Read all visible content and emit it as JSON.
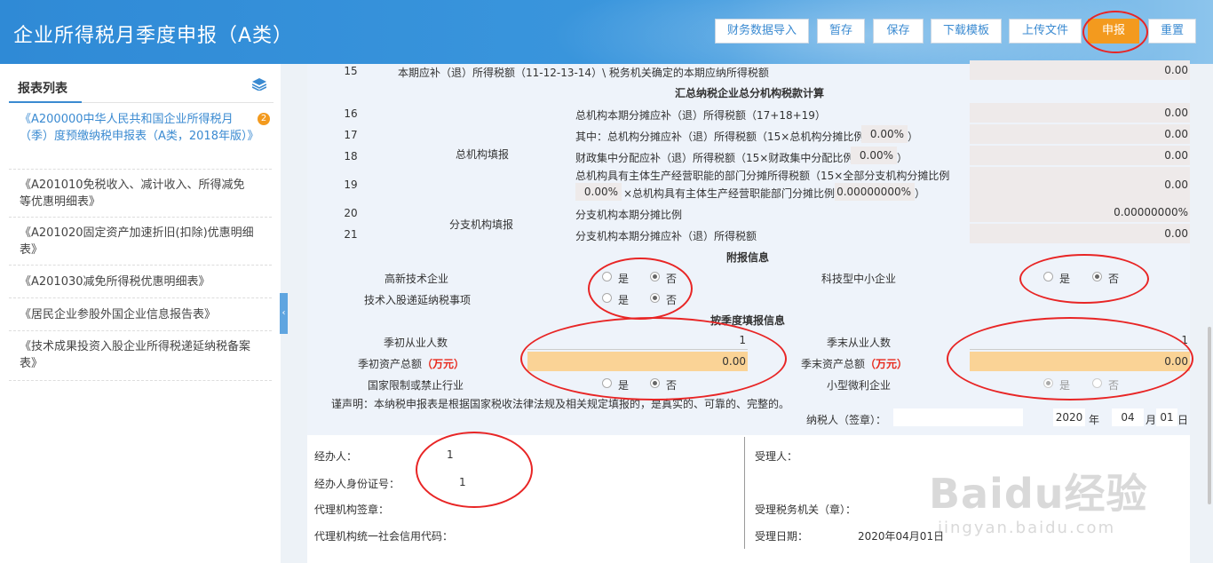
{
  "header": {
    "title": "企业所得税月季度申报（A类）",
    "buttons": [
      "财务数据导入",
      "暂存",
      "保存",
      "下载模板",
      "上传文件",
      "申报",
      "重置"
    ]
  },
  "sidebar": {
    "title": "报表列表",
    "badge": "2",
    "items": [
      "《A200000中华人民共和国企业所得税月（季）度预缴纳税申报表（A类，2018年版）》",
      "《A201010免税收入、减计收入、所得减免等优惠明细表》",
      "《A201020固定资产加速折旧(扣除)优惠明细表》",
      "《A201030减免所得税优惠明细表》",
      "《居民企业参股外国企业信息报告表》",
      "《技术成果投资入股企业所得税递延纳税备案表》"
    ]
  },
  "form": {
    "row15": {
      "num": "15",
      "label": "本期应补（退）所得税额（11-12-13-14）\\ 税务机关确定的本期应纳所得税额",
      "value": "0.00"
    },
    "section_hq": "汇总纳税企业总分机构税款计算",
    "hq_group": "总机构填报",
    "branch_group": "分支机构填报",
    "row16": {
      "num": "16",
      "label": "总机构本期分摊应补（退）所得税额（17+18+19）",
      "value": "0.00"
    },
    "row17": {
      "num": "17",
      "label_a": "其中：总机构分摊应补（退）所得税额（15×总机构分摊比例",
      "pct": "0.00%",
      "label_b": "）",
      "value": "0.00"
    },
    "row18": {
      "num": "18",
      "label_a": "财政集中分配应补（退）所得税额（15×财政集中分配比例",
      "pct": "0.00%",
      "label_b": "）",
      "value": "0.00"
    },
    "row19": {
      "num": "19",
      "label_a": "总机构具有主体生产经营职能的部门分摊所得税额（15×全部分支机构分摊比例",
      "pct1": "0.00%",
      "label_b": "×总机构具有主体生产经营职能部门分摊比例",
      "pct2": "0.00000000%",
      "label_c": "）",
      "value": "0.00"
    },
    "row20": {
      "num": "20",
      "label": "分支机构本期分摊比例",
      "value": "0.00000000%"
    },
    "row21": {
      "num": "21",
      "label": "分支机构本期分摊应补（退）所得税额",
      "value": "0.00"
    },
    "section_extra": "附报信息",
    "hightech": {
      "label": "高新技术企业",
      "yes": "是",
      "no": "否",
      "selected": "否"
    },
    "techshare": {
      "label": "技术入股递延纳税事项",
      "yes": "是",
      "no": "否",
      "selected": "否"
    },
    "sme_tech": {
      "label": "科技型中小企业",
      "yes": "是",
      "no": "否",
      "selected": "否"
    },
    "section_quarter": "按季度填报信息",
    "start_employees": {
      "label": "季初从业人数",
      "value": "1"
    },
    "end_employees": {
      "label": "季末从业人数",
      "value": "1"
    },
    "start_assets": {
      "label": "季初资产总额",
      "unit": "（万元）",
      "value": "0.00"
    },
    "end_assets": {
      "label": "季末资产总额",
      "unit": "（万元）",
      "value": "0.00"
    },
    "restricted": {
      "label": "国家限制或禁止行业",
      "yes": "是",
      "no": "否",
      "selected": "否"
    },
    "small_micro": {
      "label": "小型微利企业",
      "yes": "是",
      "no": "否",
      "selected": "是"
    },
    "declaration": "谨声明：本纳税申报表是根据国家税收法律法规及相关规定填报的，是真实的、可靠的、完整的。",
    "taxpayer_sign": "纳税人（签章）：",
    "date": {
      "year": "2020",
      "year_label": "年",
      "month": "04",
      "month_label": "月",
      "day": "01",
      "day_label": "日"
    }
  },
  "footer": {
    "handler": {
      "label": "经办人：",
      "value": "1"
    },
    "handler_id": {
      "label": "经办人身份证号：",
      "value": "1"
    },
    "agency_sign": "代理机构签章：",
    "agency_code": "代理机构统一社会信用代码：",
    "receiver": "受理人：",
    "tax_office": "受理税务机关（章）：",
    "receive_date": {
      "label": "受理日期：",
      "value": "2020年04月01日"
    }
  },
  "watermark": {
    "big": "Baidu经验",
    "small": "jingyan.baidu.com"
  },
  "colors": {
    "header_blue": "#3c98de",
    "accent_orange": "#f39a1e",
    "annotation_red": "#e82525"
  }
}
